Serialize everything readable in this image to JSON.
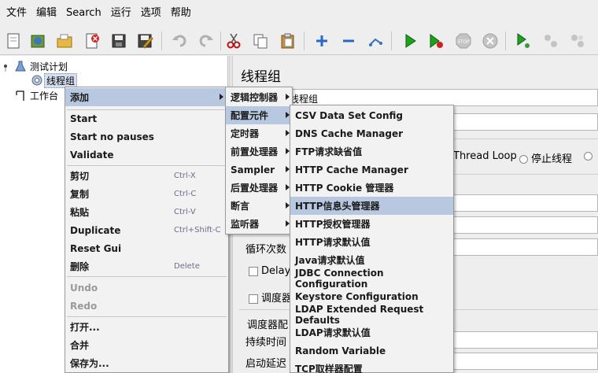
{
  "menubar": [
    "文件",
    "编辑",
    "Search",
    "运行",
    "选项",
    "帮助"
  ],
  "toolbar": {
    "icons": [
      "new-icon",
      "templates-icon",
      "open-icon",
      "close-icon",
      "save-icon",
      "save-as-icon",
      "undo-icon",
      "redo-icon",
      "cut-icon",
      "copy-icon",
      "paste-icon",
      "expand-icon",
      "collapse-icon",
      "toggle-icon",
      "start-icon",
      "start-no-pause-icon",
      "stop-icon",
      "shutdown-icon",
      "remote-start-icon",
      "remote-stop-icon",
      "remote-shutdown-icon"
    ]
  },
  "tree": {
    "test_plan": "测试计划",
    "thread_group": "线程组",
    "workbench": "工作台"
  },
  "panel": {
    "title": "线程组",
    "name_value": "线程组",
    "thread_loop": "Thread Loop",
    "stop_thread": "停止线程",
    "loop_count": "循环次数",
    "delay": "Delay",
    "scheduler": "调度器",
    "scheduler_config": "调度器配",
    "duration": "持续时间",
    "startup_delay": "启动延迟"
  },
  "context_menu": {
    "add": "添加",
    "start": "Start",
    "start_no_pauses": "Start no pauses",
    "validate": "Validate",
    "cut": "剪切",
    "cut_sc": "Ctrl-X",
    "copy": "复制",
    "copy_sc": "Ctrl-C",
    "paste": "粘贴",
    "paste_sc": "Ctrl-V",
    "duplicate": "Duplicate",
    "duplicate_sc": "Ctrl+Shift-C",
    "reset_gui": "Reset Gui",
    "delete": "删除",
    "delete_sc": "Delete",
    "undo": "Undo",
    "redo": "Redo",
    "open": "打开...",
    "merge": "合并",
    "save_as": "保存为..."
  },
  "add_submenu": {
    "logic": "逻辑控制器",
    "config": "配置元件",
    "timer": "定时器",
    "pre": "前置处理器",
    "sampler": "Sampler",
    "post": "后置处理器",
    "assertion": "断言",
    "listener": "监听器"
  },
  "config_submenu": [
    "CSV Data Set Config",
    "DNS Cache Manager",
    "FTP请求缺省值",
    "HTTP Cache Manager",
    "HTTP Cookie 管理器",
    "HTTP信息头管理器",
    "HTTP授权管理器",
    "HTTP请求默认值",
    "Java请求默认值",
    "JDBC Connection Configuration",
    "Keystore Configuration",
    "LDAP Extended Request Defaults",
    "LDAP请求默认值",
    "Random Variable",
    "TCP取样器配置"
  ],
  "colors": {
    "highlight": "#b8c8e0",
    "menu_bg": "#f2f2f2",
    "window_bg": "#eeeeee"
  }
}
